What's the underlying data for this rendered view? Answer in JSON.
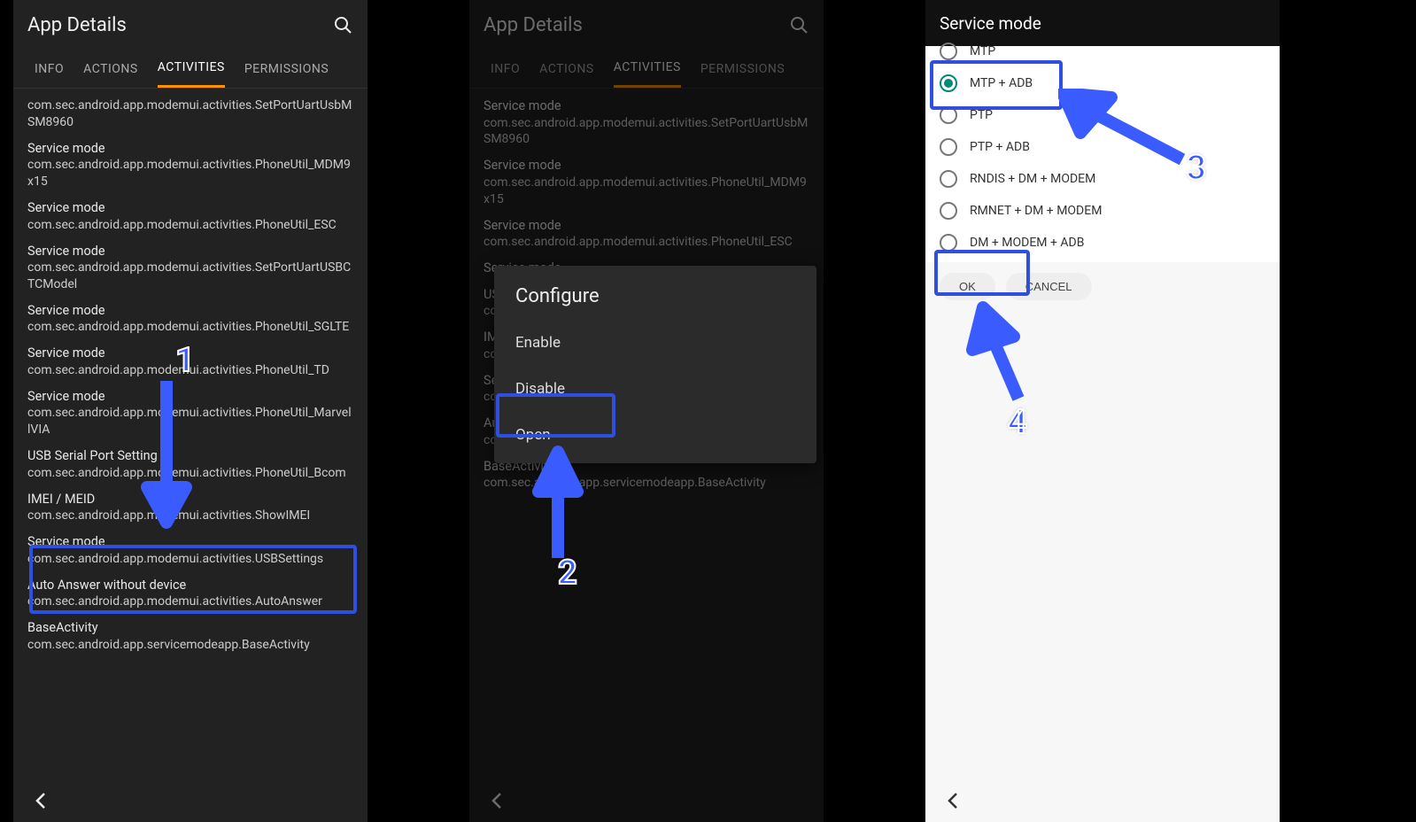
{
  "panel1": {
    "appbar_title": "App Details",
    "tabs": [
      "INFO",
      "ACTIONS",
      "ACTIVITIES",
      "PERMISSIONS"
    ],
    "active_tab_index": 2,
    "activities": [
      {
        "title": "Service mode",
        "sub": "com.sec.android.app.modemui.activities.SetPortUartUsbMSM8960",
        "partial_top": true
      },
      {
        "title": "Service mode",
        "sub": "com.sec.android.app.modemui.activities.PhoneUtil_MDM9x15"
      },
      {
        "title": "Service mode",
        "sub": "com.sec.android.app.modemui.activities.PhoneUtil_ESC"
      },
      {
        "title": "Service mode",
        "sub": "com.sec.android.app.modemui.activities.SetPortUartUSBCTCModel"
      },
      {
        "title": "Service mode",
        "sub": "com.sec.android.app.modemui.activities.PhoneUtil_SGLTE"
      },
      {
        "title": "Service mode",
        "sub": "com.sec.android.app.modemui.activities.PhoneUtil_TD"
      },
      {
        "title": "Service mode",
        "sub": "com.sec.android.app.modemui.activities.PhoneUtil_MarvellVIA"
      },
      {
        "title": "USB Serial Port Setting",
        "sub": "com.sec.android.app.modemui.activities.PhoneUtil_Bcom"
      },
      {
        "title": "IMEI / MEID",
        "sub": "com.sec.android.app.modemui.activities.ShowIMEI"
      },
      {
        "title": "Service mode",
        "sub": "com.sec.android.app.modemui.activities.USBSettings",
        "highlighted": true
      },
      {
        "title": "Auto Answer without device",
        "sub": "com.sec.android.app.modemui.activities.AutoAnswer"
      },
      {
        "title": "BaseActivity",
        "sub": "com.sec.android.app.servicemodeapp.BaseActivity"
      }
    ]
  },
  "panel2": {
    "appbar_title": "App Details",
    "tabs": [
      "INFO",
      "ACTIONS",
      "ACTIVITIES",
      "PERMISSIONS"
    ],
    "active_tab_index": 2,
    "dialog": {
      "title": "Configure",
      "items": [
        "Enable",
        "Disable",
        "Open"
      ],
      "highlighted_index": 2
    },
    "activities_visible": [
      {
        "title": "Service mode",
        "sub": "com.sec.android.app.modemui.activities.SetPortUartUsbMSM8960"
      },
      {
        "title": "Service mode",
        "sub": "com.sec.android.app.modemui.activities.PhoneUtil_MDM9x15"
      },
      {
        "title": "Service mode",
        "sub": "com.sec.android.app.modemui.activities.PhoneUtil_ESC"
      },
      {
        "title": "Service mode",
        "sub": ""
      },
      {
        "title": "USB Serial Port Setting",
        "sub": "com.sec.android.app.modemui.activities.PhoneUtil_Bcom"
      },
      {
        "title": "IMEI / MEID",
        "sub": "com.sec.android.app.modemui.activities.ShowIMEI"
      },
      {
        "title": "Service mode",
        "sub": "com.sec.android.app.modemui.activities.USBSettings"
      },
      {
        "title": "Auto Answer without device",
        "sub": "com.sec.android.app.modemui.activities.AutoAnswer"
      },
      {
        "title": "BaseActivity",
        "sub": "com.sec.android.app.servicemodeapp.BaseActivity"
      }
    ]
  },
  "panel3": {
    "appbar_title": "Service mode",
    "options": [
      {
        "label": "MTP",
        "selected": false,
        "partial_top": true
      },
      {
        "label": "MTP + ADB",
        "selected": true,
        "highlighted": true
      },
      {
        "label": "PTP",
        "selected": false
      },
      {
        "label": "PTP + ADB",
        "selected": false
      },
      {
        "label": "RNDIS + DM + MODEM",
        "selected": false
      },
      {
        "label": "RMNET + DM + MODEM",
        "selected": false
      },
      {
        "label": "DM + MODEM + ADB",
        "selected": false
      }
    ],
    "buttons": {
      "ok": "OK",
      "cancel": "CANCEL"
    },
    "highlighted_button": "ok"
  },
  "annotations": {
    "steps": [
      "1",
      "2",
      "3",
      "4"
    ],
    "box_color": "#2f4fe0"
  }
}
